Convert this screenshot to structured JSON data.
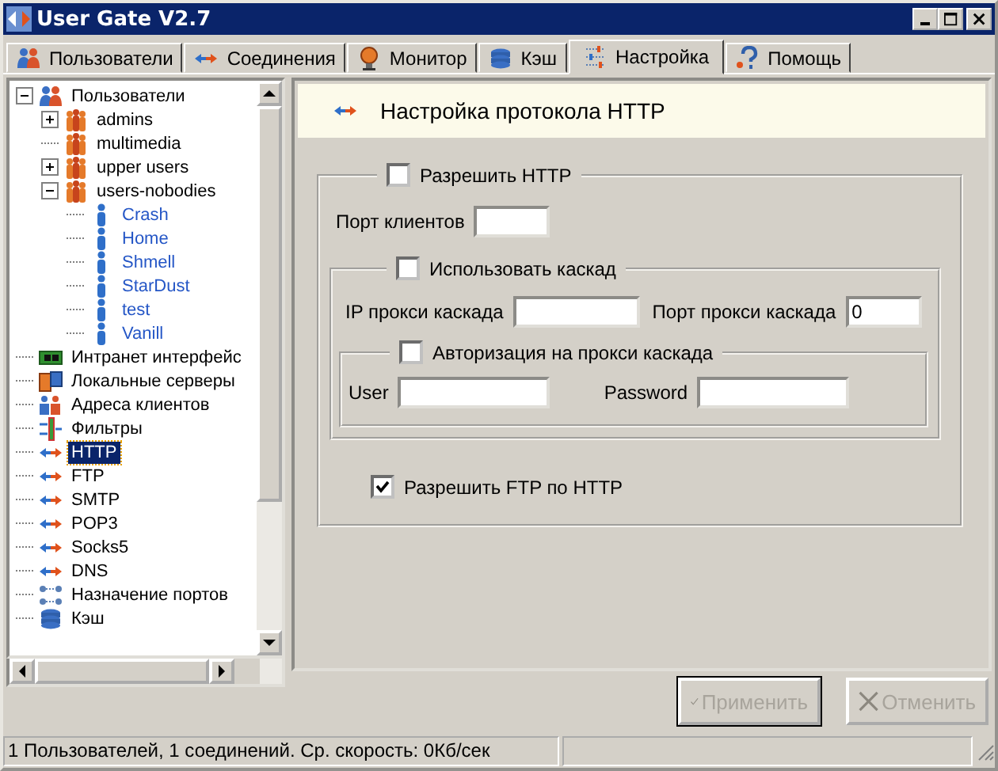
{
  "window": {
    "title": "User Gate V2.7"
  },
  "tabs": [
    {
      "label": "Пользователи",
      "selected": false
    },
    {
      "label": "Соединения",
      "selected": false
    },
    {
      "label": "Монитор",
      "selected": false
    },
    {
      "label": "Кэш",
      "selected": false
    },
    {
      "label": "Настройка",
      "selected": true
    },
    {
      "label": "Помощь",
      "selected": false
    }
  ],
  "tree": {
    "items": [
      {
        "label": "Пользователи",
        "kind": "users",
        "expanded": true,
        "selected": false,
        "children": [
          {
            "label": "admins",
            "kind": "group",
            "expanded": false,
            "selected": false
          },
          {
            "label": "multimedia",
            "kind": "group",
            "selected": false
          },
          {
            "label": "upper users",
            "kind": "group",
            "expanded": false,
            "selected": false
          },
          {
            "label": "users-nobodies",
            "kind": "group",
            "expanded": true,
            "selected": false,
            "children": [
              {
                "label": "Crash",
                "kind": "user",
                "selected": false
              },
              {
                "label": "Home",
                "kind": "user",
                "selected": false
              },
              {
                "label": "Shmell",
                "kind": "user",
                "selected": false
              },
              {
                "label": "StarDust",
                "kind": "user",
                "selected": false
              },
              {
                "label": "test",
                "kind": "user",
                "selected": false
              },
              {
                "label": "Vanill",
                "kind": "user",
                "selected": false
              }
            ]
          }
        ]
      },
      {
        "label": "Интранет интерфейс",
        "kind": "nic",
        "selected": false
      },
      {
        "label": "Локальные серверы",
        "kind": "servers",
        "selected": false
      },
      {
        "label": "Адреса клиентов",
        "kind": "clients",
        "selected": false
      },
      {
        "label": "Фильтры",
        "kind": "filter",
        "selected": false
      },
      {
        "label": "HTTP",
        "kind": "arrows",
        "selected": true
      },
      {
        "label": "FTP",
        "kind": "arrows",
        "selected": false
      },
      {
        "label": "SMTP",
        "kind": "arrows",
        "selected": false
      },
      {
        "label": "POP3",
        "kind": "arrows",
        "selected": false
      },
      {
        "label": "Socks5",
        "kind": "arrows",
        "selected": false
      },
      {
        "label": "DNS",
        "kind": "arrows",
        "selected": false
      },
      {
        "label": "Назначение портов",
        "kind": "ports",
        "selected": false
      },
      {
        "label": "Кэш",
        "kind": "cache",
        "selected": false
      }
    ]
  },
  "panel": {
    "title": "Настройка протокола HTTP",
    "allow_http": {
      "label": "Разрешить HTTP",
      "checked": false
    },
    "client_port": {
      "label": "Порт клиентов"
    },
    "cascade": {
      "label": "Использовать каскад",
      "checked": false,
      "ip_label": "IP прокси каскада",
      "port_label": "Порт прокси каскада",
      "port_value": "0",
      "auth": {
        "label": "Авторизация на прокси каскада",
        "checked": false,
        "user_label": "User",
        "password_label": "Password"
      }
    },
    "ftp_over_http": {
      "label": "Разрешить FTP по HTTP",
      "checked": true
    }
  },
  "buttons": [
    {
      "label": "Применить",
      "kind": "apply",
      "disabled": true
    },
    {
      "label": "Отменить",
      "kind": "cancel",
      "disabled": true
    }
  ],
  "status_bar": {
    "text": "1 Пользователей, 1 соединений. Ср. скорость: 0Кб/сек"
  }
}
